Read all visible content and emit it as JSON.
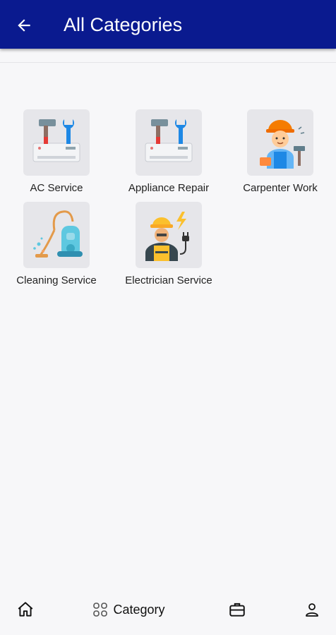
{
  "appbar": {
    "title": "All Categories",
    "back_icon": "arrow-left-icon"
  },
  "categories": [
    {
      "label": "AC Service",
      "icon": "ac-service-icon"
    },
    {
      "label": "Appliance Repair",
      "icon": "appliance-repair-icon"
    },
    {
      "label": "Carpenter Work",
      "icon": "carpenter-icon"
    },
    {
      "label": "Cleaning Service",
      "icon": "vacuum-cleaner-icon"
    },
    {
      "label": "Electrician Service",
      "icon": "electrician-icon"
    }
  ],
  "bottom_nav": {
    "items": [
      {
        "icon": "home-icon",
        "label": ""
      },
      {
        "icon": "grid-icon",
        "label": "Category",
        "active": true
      },
      {
        "icon": "briefcase-icon",
        "label": ""
      },
      {
        "icon": "user-icon",
        "label": ""
      }
    ]
  },
  "colors": {
    "appbar": "#0a1a8f",
    "background": "#f7f7f9",
    "tile_bg": "#e6e6ea"
  }
}
